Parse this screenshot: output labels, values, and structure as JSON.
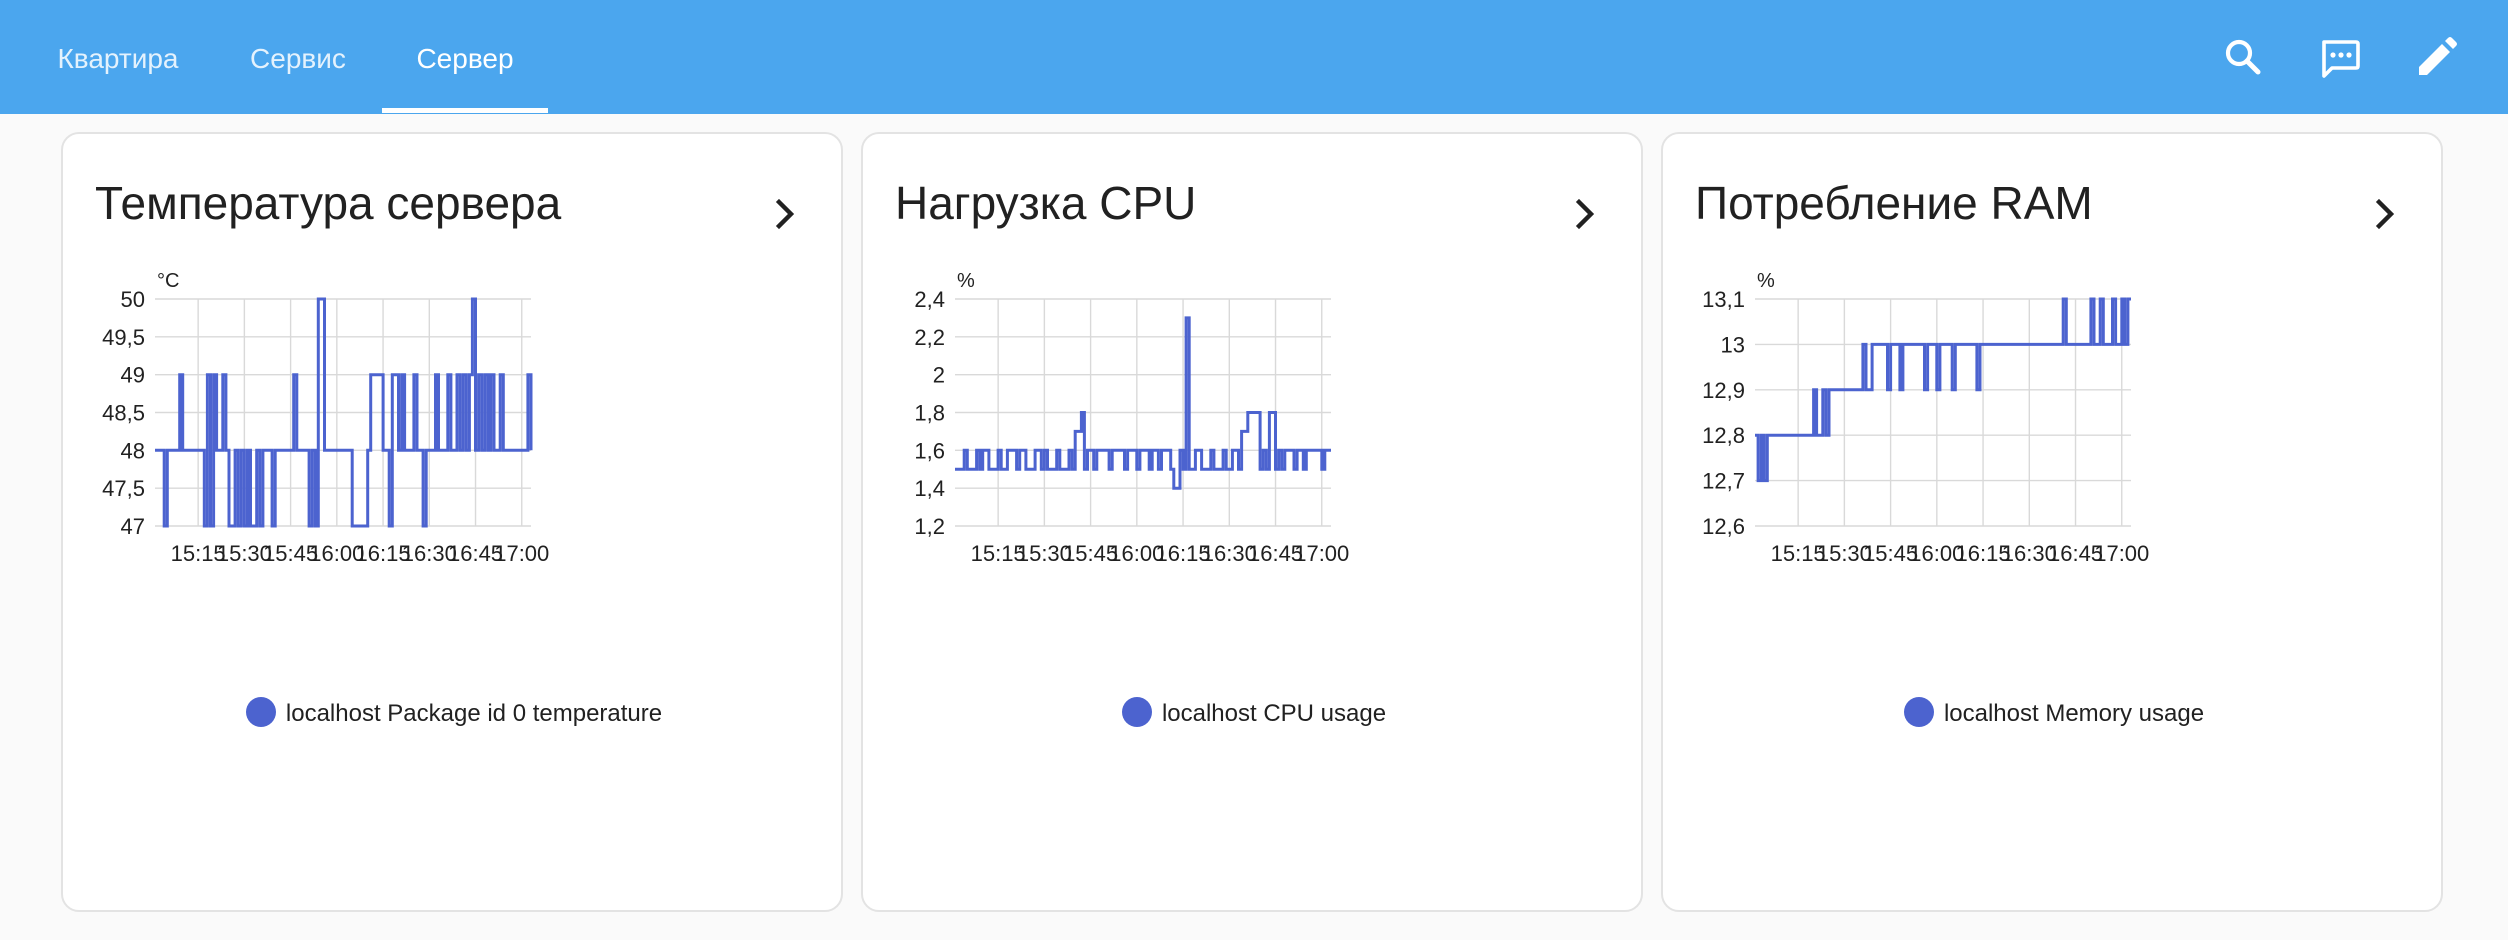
{
  "header": {
    "tabs": [
      {
        "label": "Квартира",
        "active": false
      },
      {
        "label": "Сервис",
        "active": false
      },
      {
        "label": "Сервер",
        "active": true
      }
    ],
    "icons": [
      "search-icon",
      "chat-icon",
      "pencil-icon"
    ],
    "accent": "#4ba6ee"
  },
  "cards": [
    {
      "title": "Температура сервера"
    },
    {
      "title": "Нагрузка CPU"
    },
    {
      "title": "Потребление RAM"
    }
  ],
  "chart_data": [
    {
      "type": "line",
      "step": true,
      "unit": "°C",
      "x_ticks": [
        "15:15",
        "15:30",
        "15:45",
        "16:00",
        "16:15",
        "16:30",
        "16:45",
        "17:00"
      ],
      "y_ticks": [
        "47",
        "47,5",
        "48",
        "48,5",
        "49",
        "49,5",
        "50"
      ],
      "ylim": [
        47,
        50
      ],
      "xlim": [
        "15:01",
        "17:03"
      ],
      "grid": true,
      "legend": "bottom",
      "color": "#4c63cf",
      "series": [
        {
          "name": "localhost Package id 0 temperature",
          "x": [
            "15:01",
            "15:04",
            "15:05",
            "15:08",
            "15:09",
            "15:10",
            "15:17",
            "15:18",
            "15:19",
            "15:20",
            "15:21",
            "15:22",
            "15:23",
            "15:24",
            "15:25",
            "15:27",
            "15:28",
            "15:29",
            "15:30",
            "15:31",
            "15:32",
            "15:34",
            "15:35",
            "15:36",
            "15:38",
            "15:39",
            "15:40",
            "15:46",
            "15:47",
            "15:48",
            "15:51",
            "15:52",
            "15:53",
            "15:54",
            "15:55",
            "15:56",
            "16:04",
            "16:05",
            "16:10",
            "16:11",
            "16:15",
            "16:16",
            "16:17",
            "16:18",
            "16:20",
            "16:21",
            "16:22",
            "16:24",
            "16:25",
            "16:26",
            "16:28",
            "16:29",
            "16:31",
            "16:32",
            "16:33",
            "16:34",
            "16:36",
            "16:37",
            "16:38",
            "16:39",
            "16:40",
            "16:41",
            "16:42",
            "16:43",
            "16:44",
            "16:45",
            "16:46",
            "16:47",
            "16:48",
            "16:49",
            "16:50",
            "16:51",
            "16:53",
            "16:54",
            "17:02",
            "17:03"
          ],
          "y": [
            48,
            47,
            48,
            48,
            49,
            48,
            47,
            49,
            47,
            49,
            48,
            48,
            49,
            48,
            47,
            48,
            47,
            48,
            47,
            48,
            47,
            48,
            47,
            48,
            48,
            47,
            48,
            49,
            48,
            48,
            47,
            48,
            47,
            50,
            50,
            48,
            48,
            47,
            48,
            49,
            48,
            48,
            47,
            49,
            48,
            49,
            48,
            48,
            49,
            48,
            47,
            48,
            48,
            49,
            48,
            48,
            49,
            48,
            48,
            49,
            48,
            49,
            48,
            49,
            50,
            48,
            49,
            48,
            49,
            48,
            49,
            48,
            49,
            48,
            49,
            48
          ]
        }
      ]
    },
    {
      "type": "line",
      "step": true,
      "unit": "%",
      "x_ticks": [
        "15:15",
        "15:30",
        "15:45",
        "16:00",
        "16:15",
        "16:30",
        "16:45",
        "17:00"
      ],
      "y_ticks": [
        "1,2",
        "1,4",
        "1,6",
        "1,8",
        "2",
        "2,2",
        "2,4"
      ],
      "ylim": [
        1.2,
        2.4
      ],
      "xlim": [
        "15:01",
        "17:03"
      ],
      "grid": true,
      "legend": "bottom",
      "color": "#4c63cf",
      "series": [
        {
          "name": "localhost CPU usage",
          "x": [
            "15:01",
            "15:04",
            "15:05",
            "15:08",
            "15:09",
            "15:10",
            "15:12",
            "15:15",
            "15:16",
            "15:18",
            "15:21",
            "15:22",
            "15:24",
            "15:27",
            "15:29",
            "15:30",
            "15:31",
            "15:34",
            "15:35",
            "15:38",
            "15:39",
            "15:40",
            "15:42",
            "15:43",
            "15:44",
            "15:46",
            "15:47",
            "15:51",
            "15:52",
            "15:56",
            "15:57",
            "16:00",
            "16:01",
            "16:04",
            "16:05",
            "16:07",
            "16:08",
            "16:11",
            "16:12",
            "16:14",
            "16:15",
            "16:16",
            "16:17",
            "16:19",
            "16:21",
            "16:24",
            "16:25",
            "16:28",
            "16:29",
            "16:31",
            "16:33",
            "16:34",
            "16:36",
            "16:40",
            "16:41",
            "16:42",
            "16:43",
            "16:45",
            "16:46",
            "16:47",
            "16:48",
            "16:51",
            "16:52",
            "16:54",
            "16:55",
            "17:00",
            "17:01",
            "17:03"
          ],
          "y": [
            1.5,
            1.6,
            1.5,
            1.6,
            1.5,
            1.6,
            1.5,
            1.6,
            1.5,
            1.6,
            1.5,
            1.6,
            1.5,
            1.6,
            1.5,
            1.6,
            1.5,
            1.6,
            1.5,
            1.6,
            1.5,
            1.7,
            1.8,
            1.5,
            1.6,
            1.5,
            1.6,
            1.5,
            1.6,
            1.5,
            1.6,
            1.5,
            1.6,
            1.5,
            1.6,
            1.5,
            1.6,
            1.5,
            1.4,
            1.6,
            1.5,
            2.3,
            1.5,
            1.6,
            1.5,
            1.6,
            1.5,
            1.6,
            1.5,
            1.6,
            1.5,
            1.7,
            1.8,
            1.5,
            1.6,
            1.5,
            1.8,
            1.5,
            1.6,
            1.5,
            1.6,
            1.5,
            1.6,
            1.5,
            1.6,
            1.5,
            1.6,
            1.6
          ]
        }
      ]
    },
    {
      "type": "line",
      "step": true,
      "unit": "%",
      "x_ticks": [
        "15:15",
        "15:30",
        "15:45",
        "16:00",
        "16:15",
        "16:30",
        "16:45",
        "17:00"
      ],
      "y_ticks": [
        "12,6",
        "12,7",
        "12,8",
        "12,9",
        "13",
        "13,1"
      ],
      "ylim": [
        12.6,
        13.1
      ],
      "xlim": [
        "15:01",
        "17:03"
      ],
      "grid": true,
      "legend": "bottom",
      "color": "#4c63cf",
      "series": [
        {
          "name": "localhost Memory usage",
          "x": [
            "15:01",
            "15:02",
            "15:03",
            "15:04",
            "15:05",
            "15:20",
            "15:21",
            "15:23",
            "15:24",
            "15:25",
            "15:36",
            "15:37",
            "15:39",
            "15:44",
            "15:45",
            "15:48",
            "15:49",
            "15:56",
            "15:57",
            "16:00",
            "16:01",
            "16:05",
            "16:06",
            "16:13",
            "16:14",
            "16:41",
            "16:42",
            "16:50",
            "16:51",
            "16:53",
            "16:54",
            "16:57",
            "16:58",
            "17:00",
            "17:01",
            "17:02",
            "17:03"
          ],
          "y": [
            12.8,
            12.7,
            12.8,
            12.7,
            12.8,
            12.9,
            12.8,
            12.9,
            12.8,
            12.9,
            13.0,
            12.9,
            13.0,
            12.9,
            13.0,
            12.9,
            13.0,
            12.9,
            13.0,
            12.9,
            13.0,
            12.9,
            13.0,
            12.9,
            13.0,
            13.1,
            13.0,
            13.1,
            13.0,
            13.1,
            13.0,
            13.1,
            13.0,
            13.1,
            13.0,
            13.1,
            13.1
          ]
        }
      ]
    }
  ]
}
